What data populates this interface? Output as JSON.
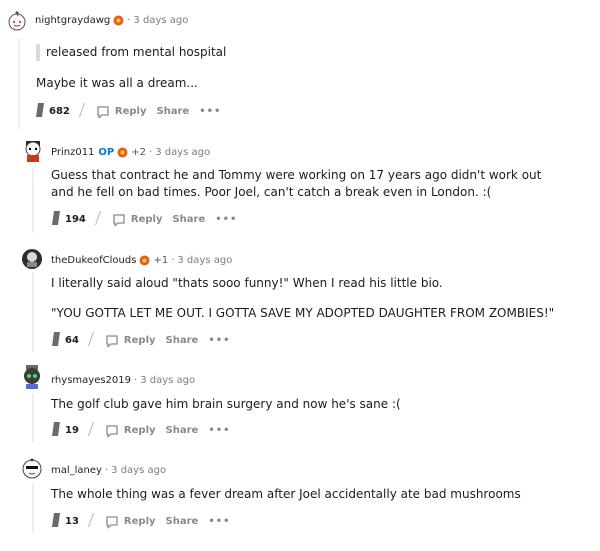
{
  "comments": [
    {
      "username": "nightgraydawg",
      "time": "3 days ago",
      "quote": "released from mental hospital",
      "body": [
        "Maybe it was all a dream..."
      ],
      "score": "682",
      "reply_label": "Reply",
      "share_label": "Share",
      "more_label": "•••"
    },
    {
      "username": "Prinz011",
      "op_label": "OP",
      "plus": "+2",
      "time": "3 days ago",
      "body": [
        "Guess that contract he and Tommy were working on 17 years ago didn't work out and he fell on bad times. Poor Joel, can't catch a break even in London. :("
      ],
      "score": "194",
      "reply_label": "Reply",
      "share_label": "Share",
      "more_label": "•••"
    },
    {
      "username": "theDukeofClouds",
      "plus": "+1",
      "time": "3 days ago",
      "body": [
        "I literally said aloud \"thats sooo funny!\" When I read his little bio.",
        "\"YOU GOTTA LET ME OUT. I GOTTA SAVE MY ADOPTED DAUGHTER FROM ZOMBIES!\""
      ],
      "score": "64",
      "reply_label": "Reply",
      "share_label": "Share",
      "more_label": "•••"
    },
    {
      "username": "rhysmayes2019",
      "time": "3 days ago",
      "body": [
        "The golf club gave him brain surgery and now he's sane :("
      ],
      "score": "19",
      "reply_label": "Reply",
      "share_label": "Share",
      "more_label": "•••"
    },
    {
      "username": "mal_laney",
      "time": "3 days ago",
      "body": [
        "The whole thing was a fever dream after Joel accidentally ate bad mushrooms"
      ],
      "score": "13",
      "reply_label": "Reply",
      "share_label": "Share",
      "more_label": "•••"
    }
  ],
  "separator": "·",
  "colors": {
    "op": "#0079d3",
    "meta": "#7c7c7c",
    "thread": "#edeff1"
  }
}
